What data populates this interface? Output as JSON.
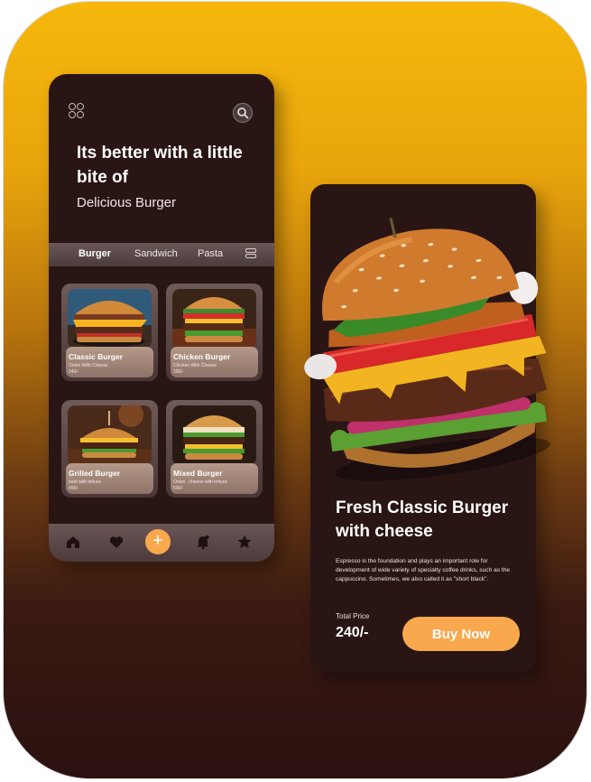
{
  "home": {
    "headline": "Its better with a little bite of",
    "subheadline": "Delicious Burger",
    "tabs": [
      {
        "label": "Burger",
        "active": true
      },
      {
        "label": "Sandwich",
        "active": false
      },
      {
        "label": "Pasta",
        "active": false
      }
    ],
    "items": [
      {
        "name": "Classic Burger",
        "description": "Onion With Cheese",
        "price": "240/-"
      },
      {
        "name": "Chicken  Burger",
        "description": "Chicken With Cheese",
        "price": "390/-"
      },
      {
        "name": "Grilled Burger",
        "description": "beef with lettuce",
        "price": "450/-"
      },
      {
        "name": "Mixed  Burger",
        "description": "Onion , cheese with lettuce",
        "price": "500/-"
      }
    ],
    "nav": [
      {
        "icon": "home-icon"
      },
      {
        "icon": "heart-icon"
      },
      {
        "icon": "plus-icon",
        "label": "+"
      },
      {
        "icon": "bell-icon"
      },
      {
        "icon": "star-icon"
      }
    ]
  },
  "detail": {
    "title": "Fresh Classic Burger with cheese",
    "description": "Espresso is the foundation and plays an important role for development of wide variety of specialty coffee drinks, such as the cappuccino. Sometimes, we also called it as \"short black\".",
    "price_label": "Total Price",
    "price": "240/-",
    "buy_label": "Buy Now"
  },
  "colors": {
    "accent": "#f9a84d",
    "panel": "#2a1515",
    "gradient_top": "#f6b80c",
    "gradient_bottom": "#2b1110"
  }
}
